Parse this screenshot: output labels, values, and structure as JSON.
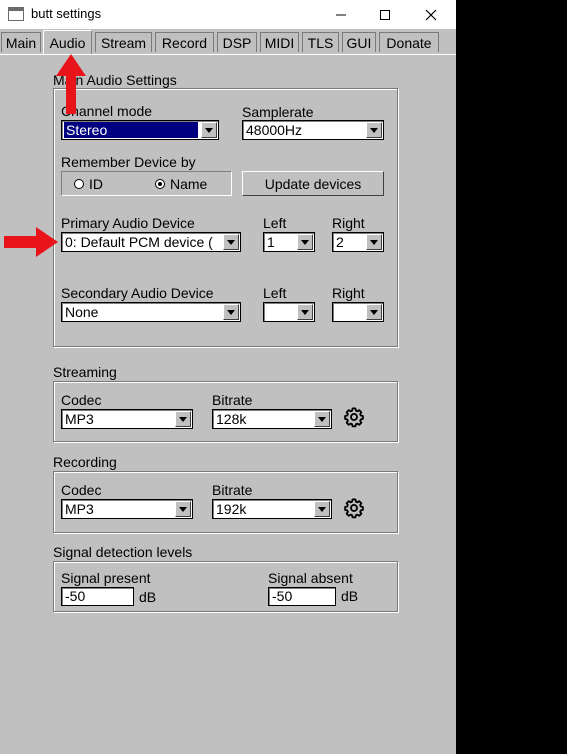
{
  "window": {
    "title": "butt settings"
  },
  "tabs": [
    "Main",
    "Audio",
    "Stream",
    "Record",
    "DSP",
    "MIDI",
    "TLS",
    "GUI",
    "Donate"
  ],
  "active_tab": "Audio",
  "main_audio": {
    "group_label": "Main Audio Settings",
    "channel_mode_label": "Channel mode",
    "channel_mode_value": "Stereo",
    "samplerate_label": "Samplerate",
    "samplerate_value": "48000Hz",
    "remember_label": "Remember Device by",
    "radio_id": "ID",
    "radio_name": "Name",
    "remember_selected": "Name",
    "update_button": "Update devices",
    "primary_label": "Primary Audio Device",
    "primary_value": "0: Default PCM device (",
    "left_label": "Left",
    "right_label": "Right",
    "primary_left": "1",
    "primary_right": "2",
    "secondary_label": "Secondary Audio Device",
    "secondary_value": "None",
    "secondary_left": "",
    "secondary_right": ""
  },
  "streaming": {
    "group_label": "Streaming",
    "codec_label": "Codec",
    "codec_value": "MP3",
    "bitrate_label": "Bitrate",
    "bitrate_value": "128k"
  },
  "recording": {
    "group_label": "Recording",
    "codec_label": "Codec",
    "codec_value": "MP3",
    "bitrate_label": "Bitrate",
    "bitrate_value": "192k"
  },
  "signal": {
    "group_label": "Signal detection levels",
    "present_label": "Signal present",
    "present_value": "-50",
    "absent_label": "Signal absent",
    "absent_value": "-50",
    "unit": "dB"
  },
  "colors": {
    "annotation_arrow": "#e8141a",
    "selection": "#000080",
    "window_bg": "#c0c0c0"
  }
}
